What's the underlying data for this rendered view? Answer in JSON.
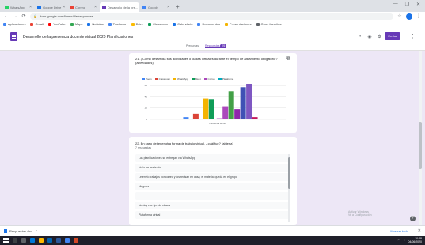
{
  "browser": {
    "tabs": [
      {
        "label": "WhatsApp",
        "color": "#25d366"
      },
      {
        "label": "Google Drive",
        "color": "#1a73e8"
      },
      {
        "label": "Correo",
        "color": "#ea4335"
      },
      {
        "label": "Desarrollo de la pre...",
        "color": "#673ab7",
        "active": true
      },
      {
        "label": "Google",
        "color": "#4285f4"
      }
    ],
    "new_tab": "+",
    "window_controls": [
      "—",
      "❐",
      "✕"
    ],
    "url": "docs.google.com/forms/d/e/responses",
    "bookmarks": [
      {
        "label": "Aplicaciones",
        "color": "#4285f4"
      },
      {
        "label": "Gmail",
        "color": "#ea4335"
      },
      {
        "label": "YouTube",
        "color": "#ff0000"
      },
      {
        "label": "Maps",
        "color": "#34a853"
      },
      {
        "label": "Noticias",
        "color": "#1a73e8"
      },
      {
        "label": "Traductor",
        "color": "#4285f4"
      },
      {
        "label": "Drive",
        "color": "#fbbc04"
      },
      {
        "label": "Classroom",
        "color": "#0f9d58"
      },
      {
        "label": "Calendario",
        "color": "#1a73e8"
      },
      {
        "label": "Documentos",
        "color": "#4285f4"
      },
      {
        "label": "Presentaciones",
        "color": "#f4b400"
      },
      {
        "label": "Otros favoritos",
        "color": "#5f6368"
      }
    ]
  },
  "form": {
    "title": "Desarrollo de la presencia docente virtual 2020 Planificaciones",
    "tabs": {
      "questions": "Preguntas",
      "responses": "Respuestas",
      "count": "76"
    },
    "send_label": "Enviar"
  },
  "question1": {
    "title": "21. ¿Cómo desarrolla sus actividades o clases virtuales durante el tiempo de aislamiento obligatorio? (actividades)",
    "legend_note": "Frecuencia de uso"
  },
  "chart_data": {
    "type": "bar",
    "categories": [
      "Zoom",
      "Classroom",
      "WhatsApp",
      "Meet",
      "Correo",
      "Plataforma",
      "Otro"
    ],
    "series": [
      {
        "color": "#4285f4",
        "values": [
          4,
          0,
          0,
          0,
          0,
          0,
          0
        ]
      },
      {
        "color": "#db4437",
        "values": [
          0,
          10,
          0,
          0,
          0,
          0,
          0
        ]
      },
      {
        "color": "#f4b400",
        "values": [
          0,
          0,
          37,
          0,
          0,
          0,
          0
        ]
      },
      {
        "color": "#0f9d58",
        "values": [
          0,
          36,
          0,
          0,
          0,
          0,
          0
        ]
      },
      {
        "color": "#ab47bc",
        "values": [
          0,
          0,
          0,
          23,
          0,
          0,
          0
        ]
      },
      {
        "color": "#00acc1",
        "values": [
          0,
          0,
          0,
          0,
          0,
          0,
          0
        ]
      },
      {
        "color": "#6d4c41",
        "values": [
          0,
          0,
          0,
          0,
          0,
          0,
          0
        ]
      },
      {
        "color": "#3949ab",
        "values": [
          0,
          0,
          0,
          0,
          0,
          0,
          0
        ]
      },
      {
        "color": "#43a047",
        "values": [
          0,
          0,
          0,
          50,
          0,
          0,
          0
        ]
      },
      {
        "color": "#8e24aa",
        "values": [
          0,
          0,
          0,
          0,
          18,
          0,
          0
        ]
      },
      {
        "color": "#3f51b5",
        "values": [
          0,
          0,
          0,
          0,
          0,
          57,
          0
        ]
      },
      {
        "color": "#7e57c2",
        "values": [
          0,
          0,
          0,
          0,
          0,
          0,
          63
        ]
      },
      {
        "color": "#c2185b",
        "values": [
          0,
          0,
          0,
          0,
          0,
          0,
          0
        ]
      }
    ],
    "bar_groups": [
      {
        "x": 1,
        "value": 4,
        "color": "#4285f4"
      },
      {
        "x": 2,
        "value": 10,
        "color": "#db4437"
      },
      {
        "x": 3,
        "value": 37,
        "color": "#f4b400"
      },
      {
        "x": 3.6,
        "value": 36,
        "color": "#0f9d58"
      },
      {
        "x": 4.4,
        "value": 2,
        "color": "#ab47bc"
      },
      {
        "x": 5,
        "value": 23,
        "color": "#ab47bc"
      },
      {
        "x": 5.6,
        "value": 50,
        "color": "#43a047"
      },
      {
        "x": 6.2,
        "value": 18,
        "color": "#8e24aa"
      },
      {
        "x": 6.8,
        "value": 57,
        "color": "#3f51b5"
      },
      {
        "x": 7.4,
        "value": 63,
        "color": "#7e57c2"
      },
      {
        "x": 8,
        "value": 4,
        "color": "#c2185b"
      }
    ],
    "legend": [
      "Zoom",
      "Classroom",
      "WhatsApp",
      "Meet",
      "Correo",
      "Plataforma"
    ],
    "yticks": [
      "60",
      "40",
      "20",
      "0"
    ],
    "ylim": [
      0,
      70
    ],
    "xlabel": "Frecuencia de uso"
  },
  "question2": {
    "title": "22. En caso de tener otra forma de trabajo virtual, ¿cuál fue? (abierta)",
    "count": "7 respuestas",
    "answers": [
      "Las planificaciones se entregan vía WhatsApp",
      "No lo he realizado",
      "Le envío trabajos por correo y los revisan en casa; el material queda en el grupo",
      "Ninguna",
      "",
      "No doy ese tipo de clases",
      "Plataforma virtual"
    ]
  },
  "footer": {
    "watermark": [
      "Activar Windows",
      "Ve a Configuración"
    ],
    "download_name": "Respuestas.xlsx",
    "show_all": "Mostrar todo",
    "clock_time": "10:28",
    "clock_date": "04/06/2020"
  }
}
